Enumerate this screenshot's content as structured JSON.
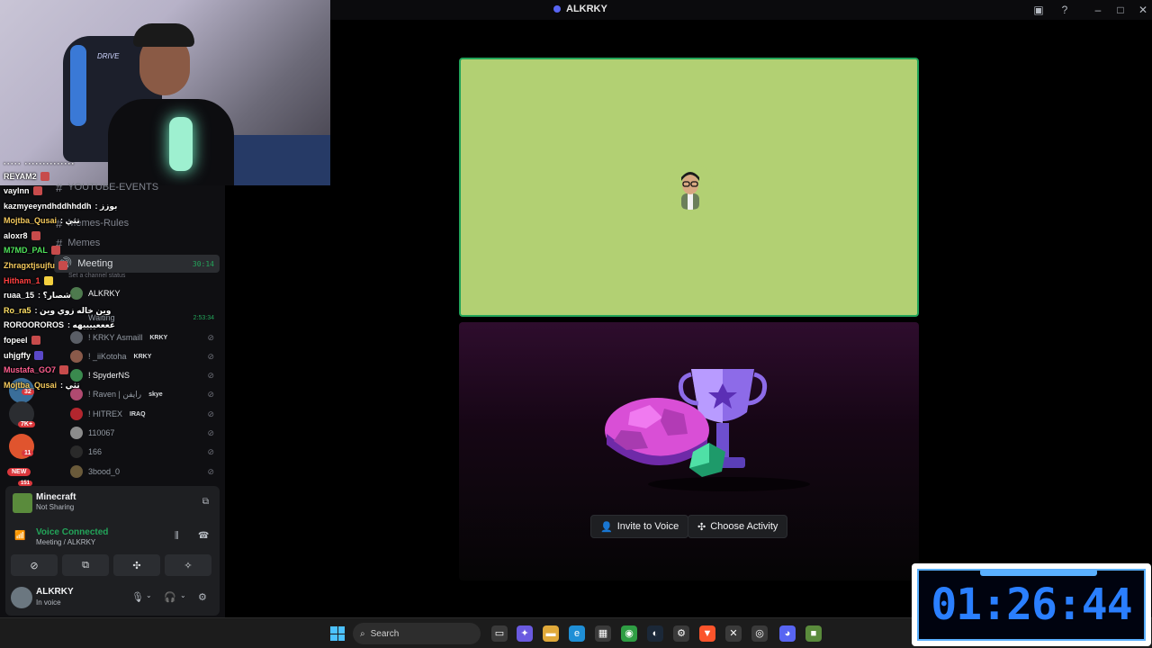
{
  "window": {
    "title": "ALKRKY",
    "icons": [
      "inbox-icon",
      "help-icon",
      "minimize-icon",
      "maximize-icon",
      "close-icon"
    ]
  },
  "channels": [
    {
      "name": "YOUTUBE-EVENTS",
      "active": false
    },
    {
      "name": "Memes-Rules",
      "active": false
    },
    {
      "name": "Memes",
      "active": false
    },
    {
      "name": "Meeting",
      "active": true,
      "timer": "30:14",
      "status_placeholder": "Set a channel status"
    }
  ],
  "members": [
    {
      "name": "ALKRKY",
      "tag": "",
      "speaking": true
    },
    {
      "name": "Waiting",
      "tag": "",
      "timer": "2:53:34"
    },
    {
      "name": "! KRKY Asmaill",
      "tag": "KRKY"
    },
    {
      "name": "! _iiKotoha",
      "tag": "KRKY"
    },
    {
      "name": "! SpyderNS",
      "tag": ""
    },
    {
      "name": "! Raven | رايفن",
      "tag": "skye"
    },
    {
      "name": "! HITREX",
      "tag": "IRAQ"
    },
    {
      "name": "110067",
      "tag": ""
    },
    {
      "name": "166",
      "tag": ""
    },
    {
      "name": "3bood_0",
      "tag": ""
    }
  ],
  "chat": [
    {
      "user": "REYAM2",
      "msg": "",
      "color": "#ffffff"
    },
    {
      "user": "vaylnn",
      "msg": "",
      "color": "#ffffff"
    },
    {
      "user": "kazmyeeyndhddhhddh",
      "msg": ": بوزز",
      "color": "#ffffff"
    },
    {
      "user": "Mojtba_Qusai",
      "msg": ": تثي",
      "color": "#f4c95d"
    },
    {
      "user": "aloxr8",
      "msg": "",
      "color": "#ffffff"
    },
    {
      "user": "M7MD_PAL",
      "msg": "",
      "color": "#4ee05a"
    },
    {
      "user": "Zhragxtjsujfu",
      "msg": "",
      "color": "#f4c95d"
    },
    {
      "user": "Hitham_1",
      "msg": "",
      "color": "#ff4040"
    },
    {
      "user": "ruaa_15",
      "msg": ": شصار؟",
      "color": "#ffffff"
    },
    {
      "user": "Ro_ra5",
      "msg": ": وين خاله زوي وين",
      "color": "#ffe066"
    },
    {
      "user": "ROROOROROS",
      "msg": ": ععععييييهه",
      "color": "#ffffff"
    },
    {
      "user": "fopeel",
      "msg": "",
      "color": "#ffffff"
    },
    {
      "user": "uhjgffy",
      "msg": "",
      "color": "#ffffff"
    },
    {
      "user": "Mustafa_GO7",
      "msg": "",
      "color": "#ff5f8f"
    },
    {
      "user": "Mojtba_Qusai",
      "msg": ": تثي",
      "color": "#f4c95d"
    }
  ],
  "servers": [
    {
      "badge": "32"
    },
    {
      "badge": "7K+"
    },
    {
      "badge": "11"
    },
    {
      "badge": "NEW"
    },
    {
      "badge": "151"
    }
  ],
  "activity": {
    "name": "Minecraft",
    "sub": "Not Sharing"
  },
  "voice": {
    "status": "Voice Connected",
    "location": "Meeting / ALKRKY"
  },
  "user": {
    "name": "ALKRKY",
    "status": "In voice"
  },
  "stage_buttons": {
    "invite": "Invite to Voice",
    "choose": "Choose Activity"
  },
  "taskbar": {
    "search_placeholder": "Search"
  },
  "timer_overlay": {
    "time": "01:26:44"
  },
  "webcam": {
    "brand": "DRIVE"
  },
  "colors": {
    "accent": "#5865f2",
    "voice_green": "#23a55a",
    "tile_bg": "#b2d073",
    "timer_blue": "#2a7fff"
  }
}
